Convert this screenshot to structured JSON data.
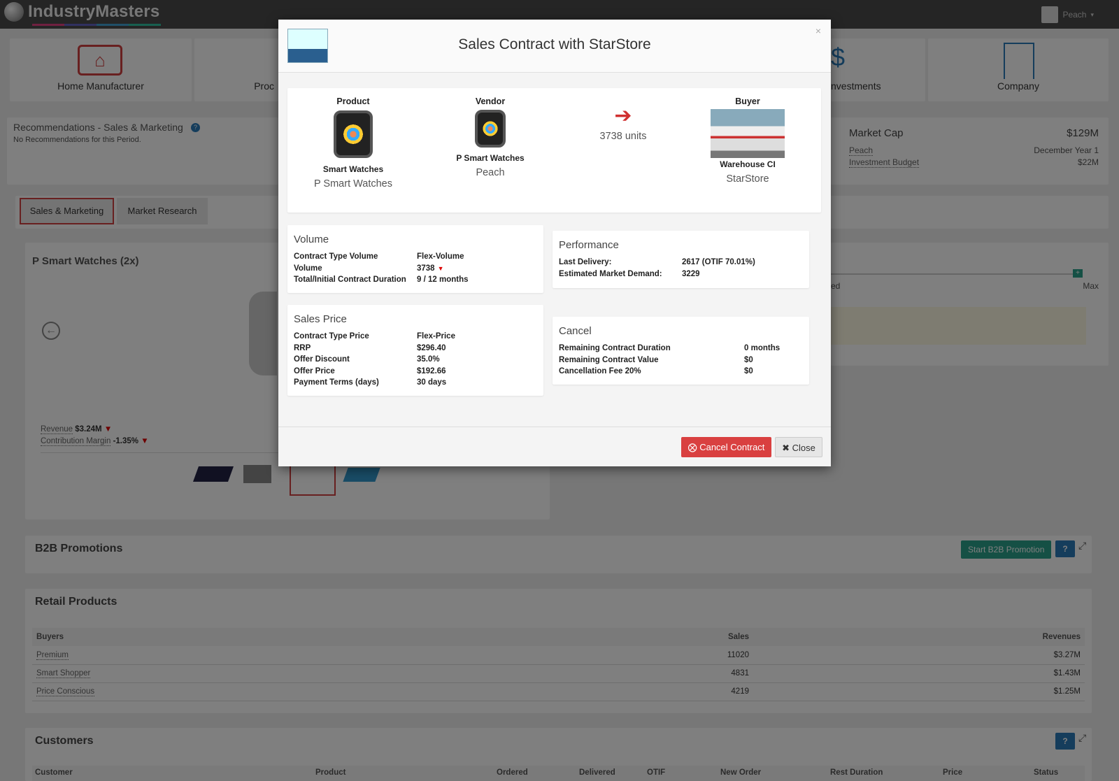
{
  "app": {
    "brand": "IndustryMasters",
    "user": "Peach"
  },
  "nav": {
    "tiles": [
      "Home Manufacturer",
      "Proc",
      "nvestments",
      "Company"
    ]
  },
  "recommendations": {
    "title": "Recommendations - Sales & Marketing",
    "text": "No Recommendations for this Period."
  },
  "market": {
    "label": "Market Cap",
    "value": "$129M",
    "company": "Peach",
    "period": "December Year 1",
    "budget_label": "Investment Budget",
    "budget": "$22M"
  },
  "tabs": [
    "Sales & Marketing",
    "Market Research"
  ],
  "product_panel": {
    "title": "P Smart Watches (2x)",
    "revenue_label": "Revenue",
    "revenue": "$3.24M",
    "margin_label": "Contribution Margin",
    "margin": "-1.35%",
    "slider_left": "ed",
    "slider_right": "Max"
  },
  "b2b": {
    "title": "B2B Promotions",
    "button": "Start B2B Promotion"
  },
  "retail": {
    "title": "Retail Products",
    "headers": [
      "Buyers",
      "Sales",
      "Revenues"
    ],
    "rows": [
      [
        "Premium",
        "11020",
        "$3.27M"
      ],
      [
        "Smart Shopper",
        "4831",
        "$1.43M"
      ],
      [
        "Price Conscious",
        "4219",
        "$1.25M"
      ]
    ]
  },
  "customers": {
    "title": "Customers",
    "headers": [
      "Customer",
      "Product",
      "Ordered",
      "Delivered",
      "OTIF",
      "New Order",
      "Rest Duration",
      "Price",
      "Status"
    ]
  },
  "modal": {
    "title": "Sales Contract with StarStore",
    "product": {
      "head": "Product",
      "name": "Smart Watches",
      "sub": "P Smart Watches"
    },
    "vendor": {
      "head": "Vendor",
      "name": "P Smart Watches",
      "sub": "Peach"
    },
    "units": "3738 units",
    "buyer": {
      "head": "Buyer",
      "name": "Warehouse CI",
      "sub": "StarStore"
    },
    "volume": {
      "title": "Volume",
      "rows": [
        [
          "Contract Type Volume",
          "Flex-Volume"
        ],
        [
          "Volume",
          "3738"
        ],
        [
          "Total/Initial Contract Duration",
          "9 / 12 months"
        ]
      ]
    },
    "performance": {
      "title": "Performance",
      "rows": [
        [
          "Last Delivery:",
          "2617 (OTIF 70.01%)"
        ],
        [
          "Estimated Market Demand:",
          "3229"
        ]
      ]
    },
    "price": {
      "title": "Sales Price",
      "rows": [
        [
          "Contract Type Price",
          "Flex-Price"
        ],
        [
          "RRP",
          "$296.40"
        ],
        [
          "Offer Discount",
          "35.0%"
        ],
        [
          "Offer Price",
          "$192.66"
        ],
        [
          "Payment Terms (days)",
          "30 days"
        ]
      ]
    },
    "cancel": {
      "title": "Cancel",
      "rows": [
        [
          "Remaining Contract Duration",
          "0 months"
        ],
        [
          "Remaining Contract Value",
          "$0"
        ],
        [
          "Cancellation Fee 20%",
          "$0"
        ]
      ]
    },
    "btn_cancel": "Cancel Contract",
    "btn_close": "Close"
  }
}
